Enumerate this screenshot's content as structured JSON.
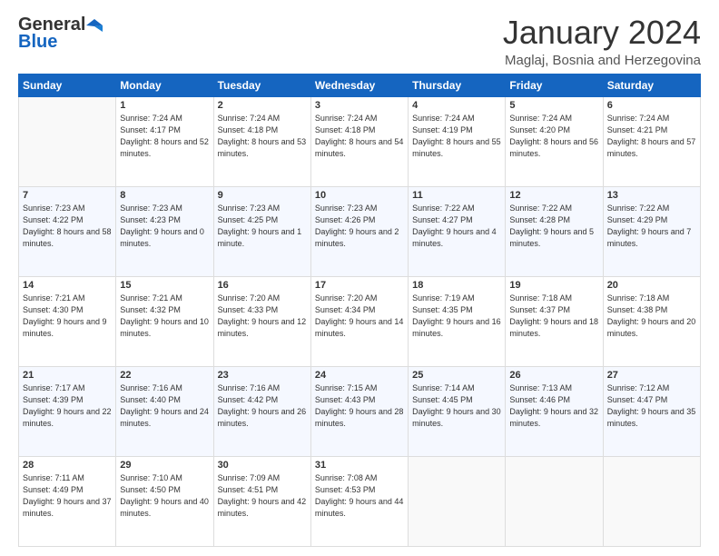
{
  "header": {
    "logo_line1": "General",
    "logo_line2": "Blue",
    "month_year": "January 2024",
    "location": "Maglaj, Bosnia and Herzegovina"
  },
  "days_of_week": [
    "Sunday",
    "Monday",
    "Tuesday",
    "Wednesday",
    "Thursday",
    "Friday",
    "Saturday"
  ],
  "weeks": [
    [
      {
        "day": "",
        "sunrise": "",
        "sunset": "",
        "daylight": ""
      },
      {
        "day": "1",
        "sunrise": "Sunrise: 7:24 AM",
        "sunset": "Sunset: 4:17 PM",
        "daylight": "Daylight: 8 hours and 52 minutes."
      },
      {
        "day": "2",
        "sunrise": "Sunrise: 7:24 AM",
        "sunset": "Sunset: 4:18 PM",
        "daylight": "Daylight: 8 hours and 53 minutes."
      },
      {
        "day": "3",
        "sunrise": "Sunrise: 7:24 AM",
        "sunset": "Sunset: 4:18 PM",
        "daylight": "Daylight: 8 hours and 54 minutes."
      },
      {
        "day": "4",
        "sunrise": "Sunrise: 7:24 AM",
        "sunset": "Sunset: 4:19 PM",
        "daylight": "Daylight: 8 hours and 55 minutes."
      },
      {
        "day": "5",
        "sunrise": "Sunrise: 7:24 AM",
        "sunset": "Sunset: 4:20 PM",
        "daylight": "Daylight: 8 hours and 56 minutes."
      },
      {
        "day": "6",
        "sunrise": "Sunrise: 7:24 AM",
        "sunset": "Sunset: 4:21 PM",
        "daylight": "Daylight: 8 hours and 57 minutes."
      }
    ],
    [
      {
        "day": "7",
        "sunrise": "Sunrise: 7:23 AM",
        "sunset": "Sunset: 4:22 PM",
        "daylight": "Daylight: 8 hours and 58 minutes."
      },
      {
        "day": "8",
        "sunrise": "Sunrise: 7:23 AM",
        "sunset": "Sunset: 4:23 PM",
        "daylight": "Daylight: 9 hours and 0 minutes."
      },
      {
        "day": "9",
        "sunrise": "Sunrise: 7:23 AM",
        "sunset": "Sunset: 4:25 PM",
        "daylight": "Daylight: 9 hours and 1 minute."
      },
      {
        "day": "10",
        "sunrise": "Sunrise: 7:23 AM",
        "sunset": "Sunset: 4:26 PM",
        "daylight": "Daylight: 9 hours and 2 minutes."
      },
      {
        "day": "11",
        "sunrise": "Sunrise: 7:22 AM",
        "sunset": "Sunset: 4:27 PM",
        "daylight": "Daylight: 9 hours and 4 minutes."
      },
      {
        "day": "12",
        "sunrise": "Sunrise: 7:22 AM",
        "sunset": "Sunset: 4:28 PM",
        "daylight": "Daylight: 9 hours and 5 minutes."
      },
      {
        "day": "13",
        "sunrise": "Sunrise: 7:22 AM",
        "sunset": "Sunset: 4:29 PM",
        "daylight": "Daylight: 9 hours and 7 minutes."
      }
    ],
    [
      {
        "day": "14",
        "sunrise": "Sunrise: 7:21 AM",
        "sunset": "Sunset: 4:30 PM",
        "daylight": "Daylight: 9 hours and 9 minutes."
      },
      {
        "day": "15",
        "sunrise": "Sunrise: 7:21 AM",
        "sunset": "Sunset: 4:32 PM",
        "daylight": "Daylight: 9 hours and 10 minutes."
      },
      {
        "day": "16",
        "sunrise": "Sunrise: 7:20 AM",
        "sunset": "Sunset: 4:33 PM",
        "daylight": "Daylight: 9 hours and 12 minutes."
      },
      {
        "day": "17",
        "sunrise": "Sunrise: 7:20 AM",
        "sunset": "Sunset: 4:34 PM",
        "daylight": "Daylight: 9 hours and 14 minutes."
      },
      {
        "day": "18",
        "sunrise": "Sunrise: 7:19 AM",
        "sunset": "Sunset: 4:35 PM",
        "daylight": "Daylight: 9 hours and 16 minutes."
      },
      {
        "day": "19",
        "sunrise": "Sunrise: 7:18 AM",
        "sunset": "Sunset: 4:37 PM",
        "daylight": "Daylight: 9 hours and 18 minutes."
      },
      {
        "day": "20",
        "sunrise": "Sunrise: 7:18 AM",
        "sunset": "Sunset: 4:38 PM",
        "daylight": "Daylight: 9 hours and 20 minutes."
      }
    ],
    [
      {
        "day": "21",
        "sunrise": "Sunrise: 7:17 AM",
        "sunset": "Sunset: 4:39 PM",
        "daylight": "Daylight: 9 hours and 22 minutes."
      },
      {
        "day": "22",
        "sunrise": "Sunrise: 7:16 AM",
        "sunset": "Sunset: 4:40 PM",
        "daylight": "Daylight: 9 hours and 24 minutes."
      },
      {
        "day": "23",
        "sunrise": "Sunrise: 7:16 AM",
        "sunset": "Sunset: 4:42 PM",
        "daylight": "Daylight: 9 hours and 26 minutes."
      },
      {
        "day": "24",
        "sunrise": "Sunrise: 7:15 AM",
        "sunset": "Sunset: 4:43 PM",
        "daylight": "Daylight: 9 hours and 28 minutes."
      },
      {
        "day": "25",
        "sunrise": "Sunrise: 7:14 AM",
        "sunset": "Sunset: 4:45 PM",
        "daylight": "Daylight: 9 hours and 30 minutes."
      },
      {
        "day": "26",
        "sunrise": "Sunrise: 7:13 AM",
        "sunset": "Sunset: 4:46 PM",
        "daylight": "Daylight: 9 hours and 32 minutes."
      },
      {
        "day": "27",
        "sunrise": "Sunrise: 7:12 AM",
        "sunset": "Sunset: 4:47 PM",
        "daylight": "Daylight: 9 hours and 35 minutes."
      }
    ],
    [
      {
        "day": "28",
        "sunrise": "Sunrise: 7:11 AM",
        "sunset": "Sunset: 4:49 PM",
        "daylight": "Daylight: 9 hours and 37 minutes."
      },
      {
        "day": "29",
        "sunrise": "Sunrise: 7:10 AM",
        "sunset": "Sunset: 4:50 PM",
        "daylight": "Daylight: 9 hours and 40 minutes."
      },
      {
        "day": "30",
        "sunrise": "Sunrise: 7:09 AM",
        "sunset": "Sunset: 4:51 PM",
        "daylight": "Daylight: 9 hours and 42 minutes."
      },
      {
        "day": "31",
        "sunrise": "Sunrise: 7:08 AM",
        "sunset": "Sunset: 4:53 PM",
        "daylight": "Daylight: 9 hours and 44 minutes."
      },
      {
        "day": "",
        "sunrise": "",
        "sunset": "",
        "daylight": ""
      },
      {
        "day": "",
        "sunrise": "",
        "sunset": "",
        "daylight": ""
      },
      {
        "day": "",
        "sunrise": "",
        "sunset": "",
        "daylight": ""
      }
    ]
  ]
}
